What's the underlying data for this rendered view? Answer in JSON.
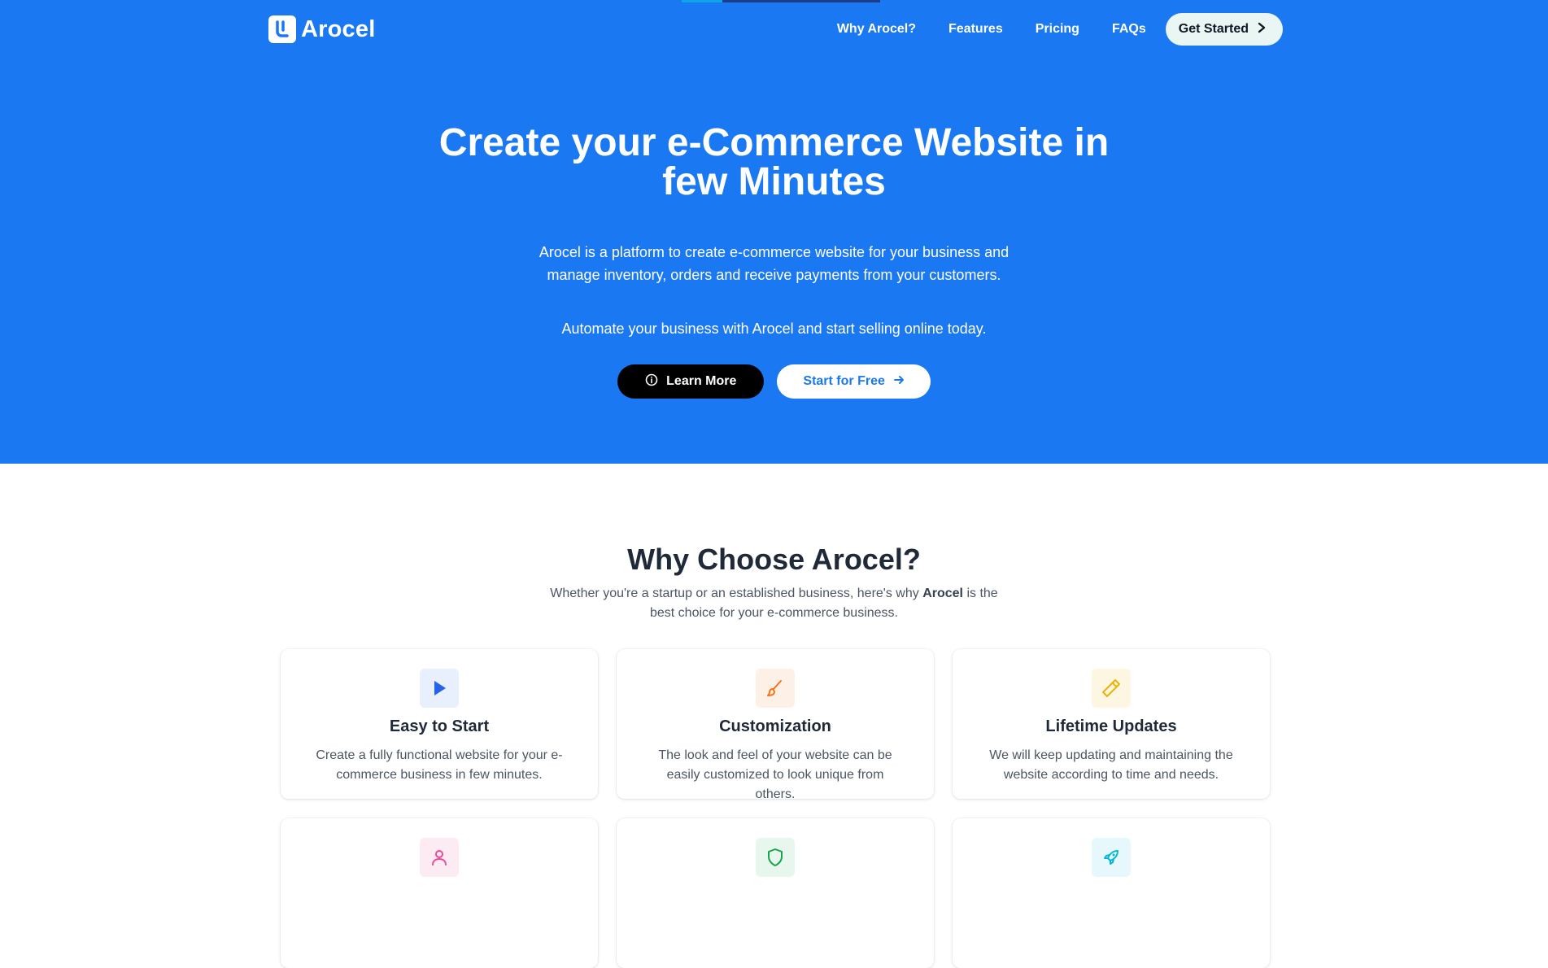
{
  "brand": {
    "name": "Arocel",
    "logo_icon": "arocel-logo-icon"
  },
  "nav": {
    "links": [
      "Why Arocel?",
      "Features",
      "Pricing",
      "FAQs"
    ],
    "cta_label": "Get Started"
  },
  "hero": {
    "title": "Create your e-Commerce Website in few Minutes",
    "description": "Arocel is a platform to create e-commerce website for your business and manage inventory, orders and receive payments from your customers.",
    "subtext": "Automate your business with Arocel and start selling online today.",
    "learn_more_label": "Learn More",
    "start_free_label": "Start for Free"
  },
  "why": {
    "title": "Why Choose Arocel?",
    "desc_before": "Whether you're a startup or an established business, here's why",
    "desc_brand": "Arocel",
    "desc_after": "is the best choice for your e-commerce business.",
    "cards": [
      {
        "title": "Easy to Start",
        "desc": "Create a fully functional website for your e-commerce business in few minutes.",
        "icon": "play-icon"
      },
      {
        "title": "Customization",
        "desc": "The look and feel of your website can be easily customized to look unique from others.",
        "icon": "paintbrush-icon"
      },
      {
        "title": "Lifetime Updates",
        "desc": "We will keep updating and maintaining the website according to time and needs.",
        "icon": "wrench-icon"
      },
      {
        "title": "",
        "desc": "",
        "icon": "user-icon"
      },
      {
        "title": "",
        "desc": "",
        "icon": "shield-icon"
      },
      {
        "title": "",
        "desc": "",
        "icon": "rocket-icon"
      }
    ]
  },
  "colors": {
    "hero_bg": "#1a78f2",
    "cta_bg": "#e9f6f3",
    "dark_button": "#000000",
    "play_icon": "#2563eb",
    "brush_icon": "#f97316",
    "wrench_icon": "#eab308",
    "user_icon": "#ec4899",
    "shield_icon": "#16a34a",
    "rocket_icon": "#06b6d4"
  }
}
